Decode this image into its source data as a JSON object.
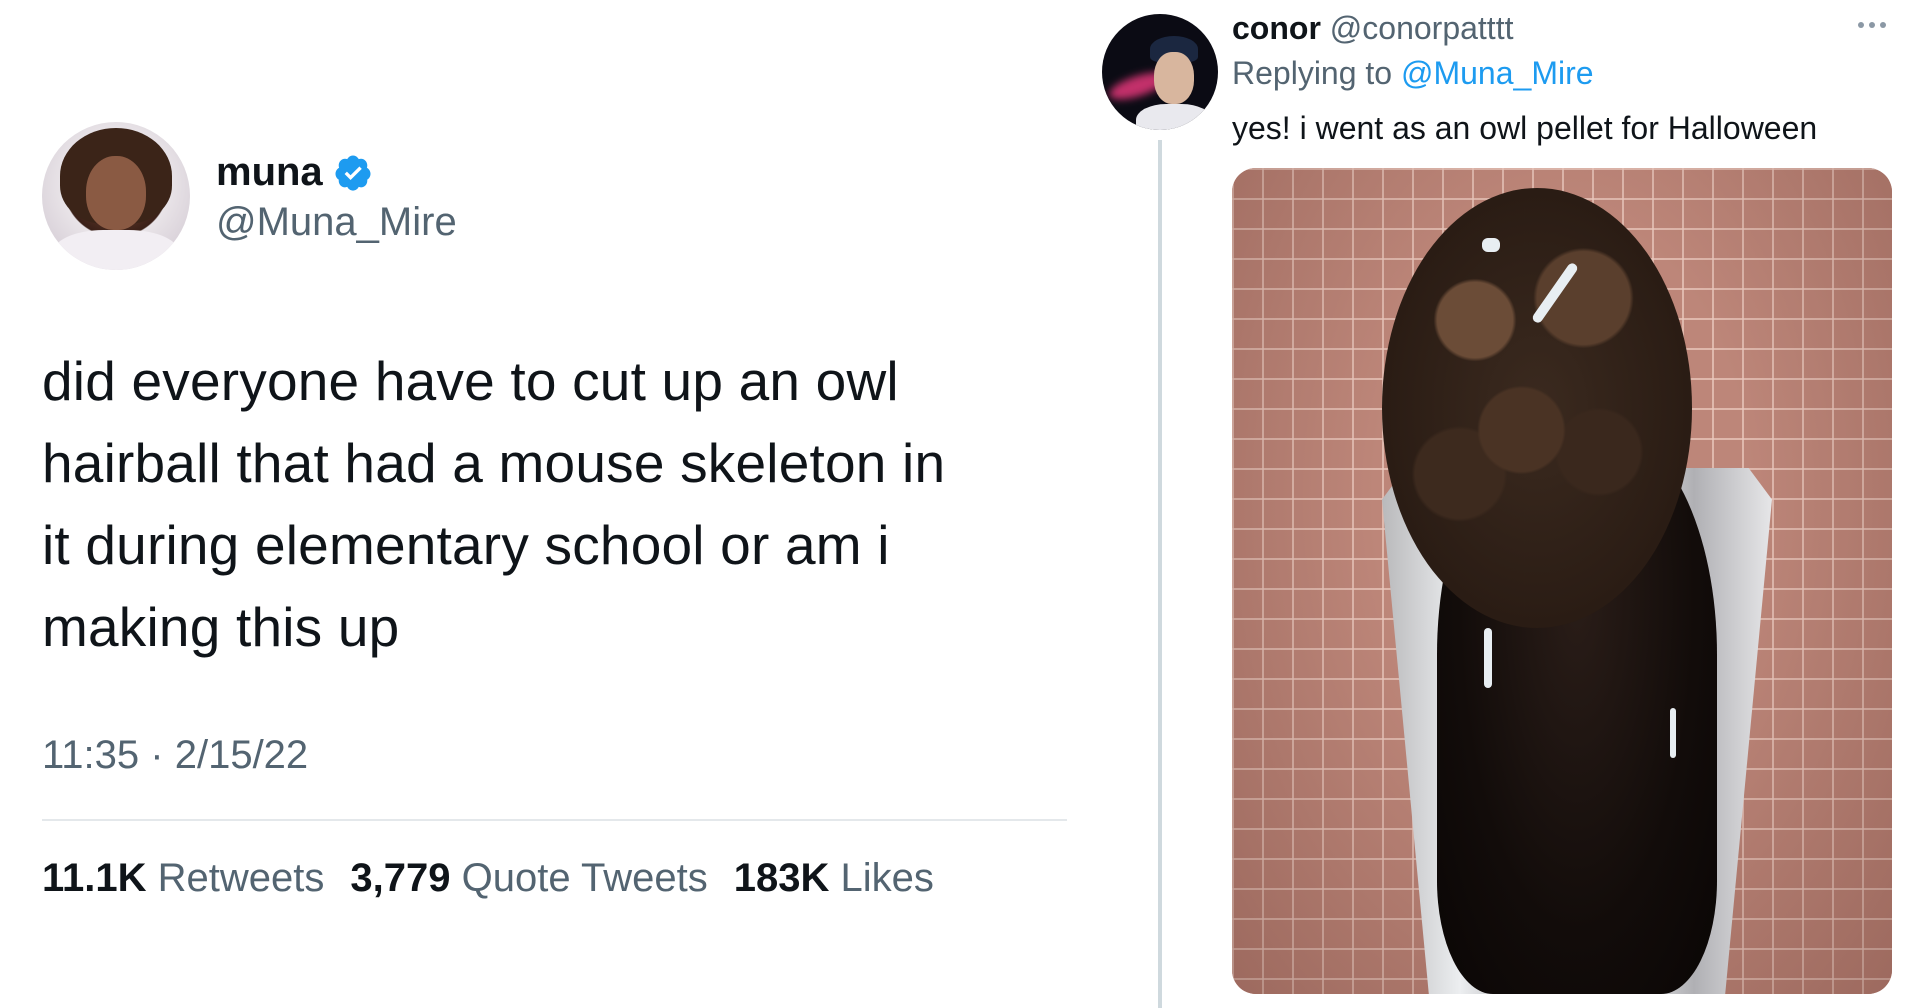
{
  "left_tweet": {
    "display_name": "muna",
    "handle": "@Muna_Mire",
    "text_lines": [
      "did everyone have to cut up an owl",
      "hairball that had a mouse skeleton in",
      "it during elementary school or am i",
      "making this up"
    ],
    "time": "11:35",
    "date": "2/15/22",
    "meta_separator": "·",
    "stats": {
      "retweets_count": "11.1K",
      "retweets_label": "Retweets",
      "quotes_count": "3,779",
      "quotes_label": "Quote Tweets",
      "likes_count": "183K",
      "likes_label": "Likes"
    },
    "verified_color": "#1d9bf0"
  },
  "reply_tweet": {
    "display_name": "conor",
    "handle": "@conorpatttt",
    "replying_prefix": "Replying to",
    "replying_to": "@Muna_Mire",
    "text": "yes! i went as an owl pellet for Halloween"
  },
  "colors": {
    "text_primary": "#0f1419",
    "text_secondary": "#536471",
    "link": "#1d9bf0",
    "divider": "#e4e8eb"
  }
}
